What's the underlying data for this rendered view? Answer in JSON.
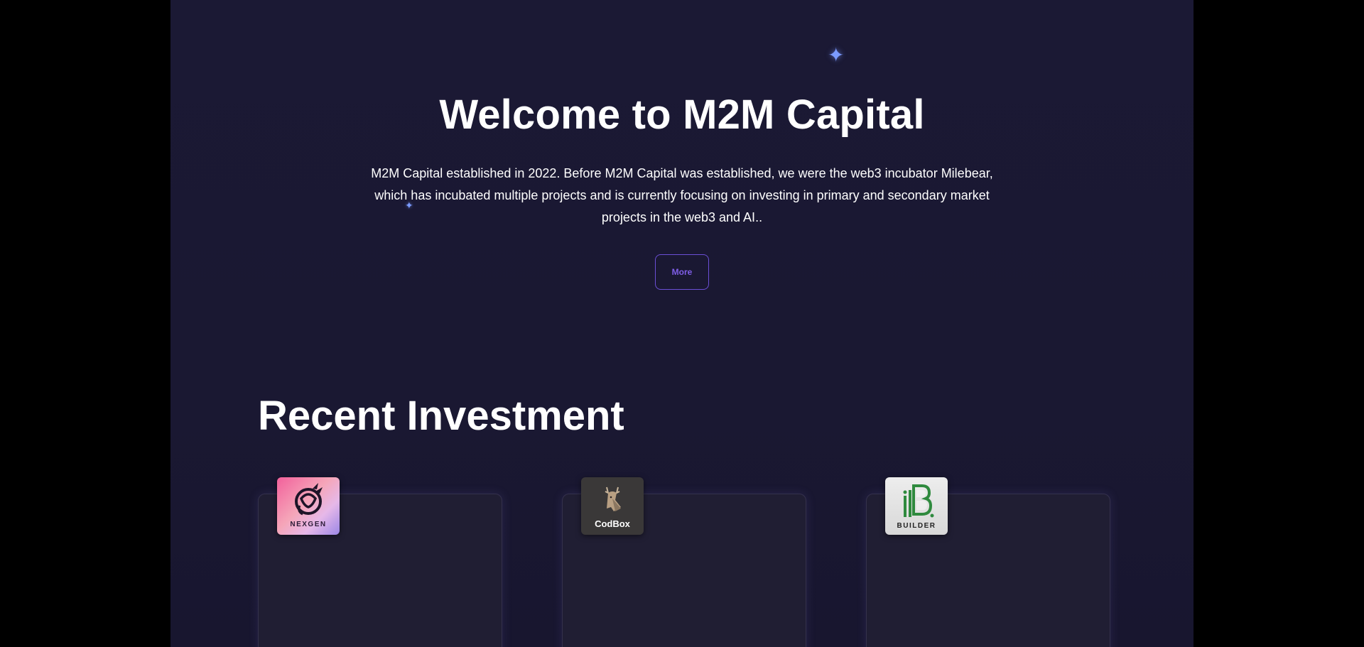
{
  "hero": {
    "title": "Welcome to M2M Capital",
    "description": "M2M Capital established in 2022. Before M2M Capital was established, we were the web3 incubator Milebear, which has incubated multiple projects and is currently focusing on investing in primary and secondary market projects in the web3 and AI..",
    "more_label": "More"
  },
  "sparkles": {
    "glyph": "✦"
  },
  "investments": {
    "title": "Recent Investment",
    "items": [
      {
        "logo_text": "NEXGEN",
        "logo_icon": "dragon-icon"
      },
      {
        "logo_text": "CodBox",
        "logo_icon": "deer-icon"
      },
      {
        "logo_text": "BUILDER",
        "logo_icon": "building-b-icon"
      }
    ]
  },
  "colors": {
    "page_background": "#1b1934",
    "outer_background": "#000000",
    "accent_purple": "#7f5ee8",
    "sparkle_blue": "#7b9bff",
    "card_background": "#201e33"
  }
}
